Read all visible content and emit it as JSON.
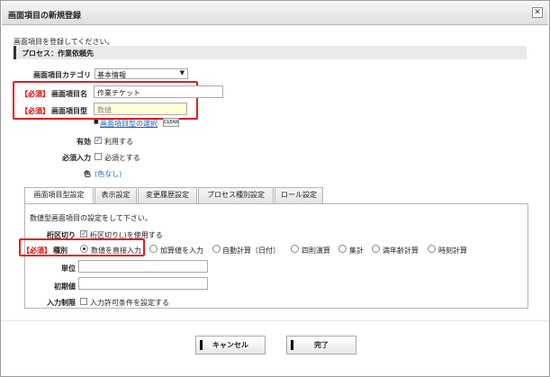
{
  "window": {
    "title": "画面項目の新規登録"
  },
  "icons": {
    "close": "close-icon",
    "select_arrow": "chevron-down-icon"
  },
  "intro_text": "画面項目を登録してください。",
  "process": {
    "label": "プロセス：作業依頼先"
  },
  "form": {
    "category_label": "画面項目カテゴリ",
    "category_value": "基本情報",
    "required_mark": "【必須】",
    "name_label": "画面項目名",
    "name_value": "作業チケット",
    "type_label": "画面項目型",
    "type_value": "数値",
    "type_link": "画面項目型の選択",
    "clear_label": "CLEAR",
    "enabled_label": "有効",
    "enabled_option": "利用する",
    "enabled_checked": true,
    "required_label": "必須入力",
    "required_option": "必須とする",
    "required_checked": false,
    "color_label": "色",
    "color_value": "(色なし)"
  },
  "tabs": [
    {
      "label": "画面項目型設定",
      "active": true
    },
    {
      "label": "表示設定",
      "active": false
    },
    {
      "label": "変更履歴設定",
      "active": false
    },
    {
      "label": "プロセス種別設定",
      "active": false
    },
    {
      "label": "ロール設定",
      "active": false
    }
  ],
  "panel": {
    "intro": "数値型画面項目の設定をして下さい。",
    "separator_label": "桁区切り",
    "separator_option": "桁区切り(,)を使用する",
    "separator_checked": true,
    "kind_required_mark": "【必須】",
    "kind_label": "種別",
    "kind_options": [
      "数値を直接入力",
      "加算値を入力",
      "自動計算（日付）",
      "四則演算",
      "集計",
      "満年齢計算",
      "時刻計算"
    ],
    "kind_selected": 0,
    "unit_label": "単位",
    "initial_label": "初期値",
    "limit_label": "入力制限",
    "limit_option": "入力許可条件を設定する",
    "limit_checked": false
  },
  "buttons": {
    "cancel": "キャンセル",
    "done": "完了"
  },
  "colors": {
    "required": "#dd0000",
    "highlight_box": "#e02020",
    "link": "#1a5fb4"
  }
}
